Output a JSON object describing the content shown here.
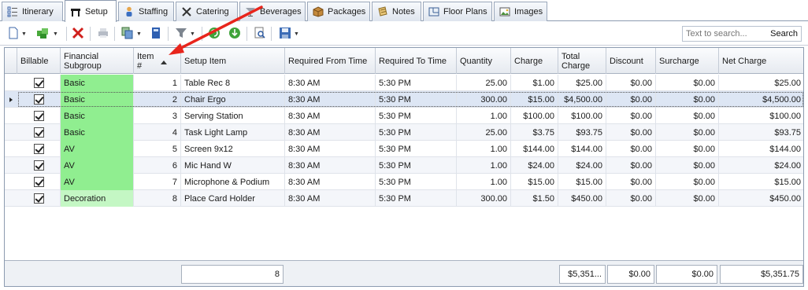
{
  "tabs": [
    {
      "label": "Itinerary",
      "icon": "itinerary-icon"
    },
    {
      "label": "Setup",
      "icon": "table-icon"
    },
    {
      "label": "Staffing",
      "icon": "person-icon"
    },
    {
      "label": "Catering",
      "icon": "utensils-icon"
    },
    {
      "label": "Beverages",
      "icon": "cocktail-icon"
    },
    {
      "label": "Packages",
      "icon": "package-icon"
    },
    {
      "label": "Notes",
      "icon": "notes-icon"
    },
    {
      "label": "Floor Plans",
      "icon": "floor-plan-icon"
    },
    {
      "label": "Images",
      "icon": "image-icon"
    }
  ],
  "active_tab": "Setup",
  "toolbar": {
    "buttons": [
      "new-icon",
      "add-green-icon",
      "delete-icon",
      "print-icon",
      "copy-icon",
      "book-icon",
      "filter-icon",
      "refresh-icon",
      "download-icon",
      "find-icon",
      "save-icon"
    ]
  },
  "search": {
    "placeholder": "Text to search...",
    "button_label": "Search"
  },
  "grid": {
    "columns": [
      "Billable",
      "Financial\nSubgroup",
      "Item\n#",
      "Setup Item",
      "Required From Time",
      "Required To Time",
      "Quantity",
      "Charge",
      "Total\nCharge",
      "Discount",
      "Surcharge",
      "Net Charge"
    ],
    "sorted_column": "Item #",
    "sort_direction": "ascending",
    "rows": [
      {
        "billable": true,
        "subgroup": "Basic",
        "item": "1",
        "setup_item": "Table Rec 8",
        "from": "8:30 AM",
        "to": "5:30 PM",
        "quantity": "25.00",
        "charge": "$1.00",
        "total": "$25.00",
        "discount": "$0.00",
        "surcharge": "$0.00",
        "net": "$25.00"
      },
      {
        "billable": true,
        "subgroup": "Basic",
        "item": "2",
        "setup_item": "Chair Ergo",
        "from": "8:30 AM",
        "to": "5:30 PM",
        "quantity": "300.00",
        "charge": "$15.00",
        "total": "$4,500.00",
        "discount": "$0.00",
        "surcharge": "$0.00",
        "net": "$4,500.00"
      },
      {
        "billable": true,
        "subgroup": "Basic",
        "item": "3",
        "setup_item": "Serving Station",
        "from": "8:30 AM",
        "to": "5:30 PM",
        "quantity": "1.00",
        "charge": "$100.00",
        "total": "$100.00",
        "discount": "$0.00",
        "surcharge": "$0.00",
        "net": "$100.00"
      },
      {
        "billable": true,
        "subgroup": "Basic",
        "item": "4",
        "setup_item": "Task Light Lamp",
        "from": "8:30 AM",
        "to": "5:30 PM",
        "quantity": "25.00",
        "charge": "$3.75",
        "total": "$93.75",
        "discount": "$0.00",
        "surcharge": "$0.00",
        "net": "$93.75"
      },
      {
        "billable": true,
        "subgroup": "AV",
        "item": "5",
        "setup_item": "Screen 9x12",
        "from": "8:30 AM",
        "to": "5:30 PM",
        "quantity": "1.00",
        "charge": "$144.00",
        "total": "$144.00",
        "discount": "$0.00",
        "surcharge": "$0.00",
        "net": "$144.00"
      },
      {
        "billable": true,
        "subgroup": "AV",
        "item": "6",
        "setup_item": "Mic Hand W",
        "from": "8:30 AM",
        "to": "5:30 PM",
        "quantity": "1.00",
        "charge": "$24.00",
        "total": "$24.00",
        "discount": "$0.00",
        "surcharge": "$0.00",
        "net": "$24.00"
      },
      {
        "billable": true,
        "subgroup": "AV",
        "item": "7",
        "setup_item": "Microphone & Podium",
        "from": "8:30 AM",
        "to": "5:30 PM",
        "quantity": "1.00",
        "charge": "$15.00",
        "total": "$15.00",
        "discount": "$0.00",
        "surcharge": "$0.00",
        "net": "$15.00"
      },
      {
        "billable": true,
        "subgroup": "Decoration",
        "item": "8",
        "setup_item": "Place Card Holder",
        "from": "8:30 AM",
        "to": "5:30 PM",
        "quantity": "300.00",
        "charge": "$1.50",
        "total": "$450.00",
        "discount": "$0.00",
        "surcharge": "$0.00",
        "net": "$450.00"
      }
    ],
    "focused_row": 2,
    "footer": {
      "item_count": "8",
      "total_charge": "$5,351...",
      "discount": "$0.00",
      "surcharge": "$0.00",
      "net_charge": "$5,351.75"
    }
  },
  "colors": {
    "subgroup_basic": "#90ee90",
    "subgroup_decoration": "#c4f7c4",
    "annotation_arrow": "#e8251c",
    "focused_row": "#dde6f4"
  }
}
